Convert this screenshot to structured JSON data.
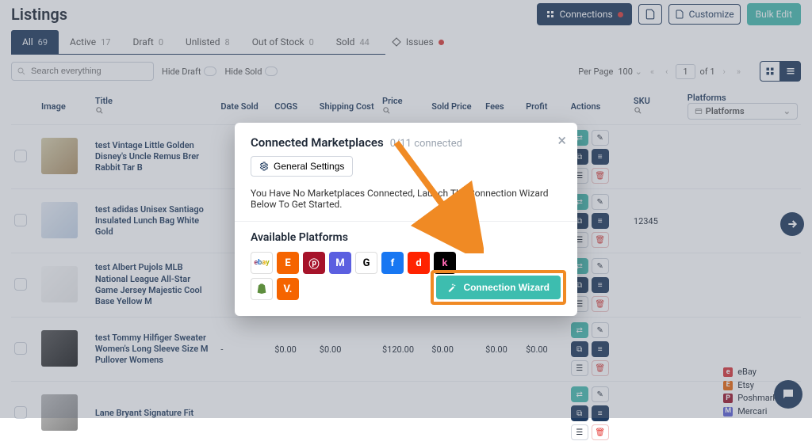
{
  "header": {
    "title": "Listings",
    "connections": "Connections",
    "customize": "Customize",
    "bulk_edit": "Bulk Edit"
  },
  "tabs": [
    {
      "label": "All",
      "count": "69"
    },
    {
      "label": "Active",
      "count": "17"
    },
    {
      "label": "Draft",
      "count": "0"
    },
    {
      "label": "Unlisted",
      "count": "8"
    },
    {
      "label": "Out of Stock",
      "count": "0"
    },
    {
      "label": "Sold",
      "count": "44"
    },
    {
      "label": "Issues",
      "count": ""
    }
  ],
  "toolbar": {
    "search_placeholder": "Search everything",
    "hide_draft": "Hide Draft",
    "hide_sold": "Hide Sold",
    "per_page": "Per Page",
    "per_page_value": "100",
    "page": "1",
    "of": "of 1"
  },
  "columns": {
    "image": "Image",
    "title": "Title",
    "date_sold": "Date Sold",
    "cogs": "COGS",
    "shipping": "Shipping Cost",
    "price": "Price",
    "sold_price": "Sold Price",
    "fees": "Fees",
    "profit": "Profit",
    "actions": "Actions",
    "sku": "SKU",
    "platforms": "Platforms",
    "platforms_chip": "Platforms"
  },
  "rows": [
    {
      "title": "test Vintage Little Golden Disney's Uncle Remus Brer Rabbit Tar B",
      "date_sold": "",
      "cogs": "",
      "ship": "",
      "price": "",
      "sold": "",
      "fees": "",
      "profit": "",
      "sku": "",
      "thumb": "brown"
    },
    {
      "title": "test adidas Unisex Santiago Insulated Lunch Bag White Gold",
      "date_sold": "",
      "cogs": "",
      "ship": "",
      "price": "",
      "sold": "",
      "fees": "",
      "profit": "",
      "sku": "12345",
      "thumb": "blue"
    },
    {
      "title": "test Albert Pujols MLB National League All-Star Game Jersey Majestic Cool Base Yellow M",
      "date_sold": "",
      "cogs": "",
      "ship": "",
      "price": "",
      "sold": "",
      "fees": "",
      "profit": "",
      "sku": "",
      "thumb": "white"
    },
    {
      "title": "test Tommy Hilfiger Sweater Women's Long Sleeve Size M Pullover Womens",
      "date_sold": "-",
      "cogs": "$0.00",
      "ship": "$0.00",
      "price": "$120.00",
      "sold": "$0.00",
      "fees": "$0.00",
      "profit": "$0.00",
      "sku": "",
      "thumb": "dark"
    },
    {
      "title": "Lane Bryant Signature Fit",
      "date_sold": "",
      "cogs": "",
      "ship": "",
      "price": "",
      "sold": "",
      "fees": "",
      "profit": "",
      "sku": "",
      "thumb": "grey"
    }
  ],
  "modal": {
    "title": "Connected Marketplaces",
    "subtitle": "0/11 connected",
    "general": "General Settings",
    "message": "You Have No Marketplaces Connected, Launch The Connection Wizard Below To Get Started.",
    "available": "Available Platforms",
    "wizard": "Connection Wizard"
  },
  "legend": {
    "ebay": "eBay",
    "etsy": "Etsy",
    "poshmark": "Poshmark",
    "mercari": "Mercari"
  }
}
